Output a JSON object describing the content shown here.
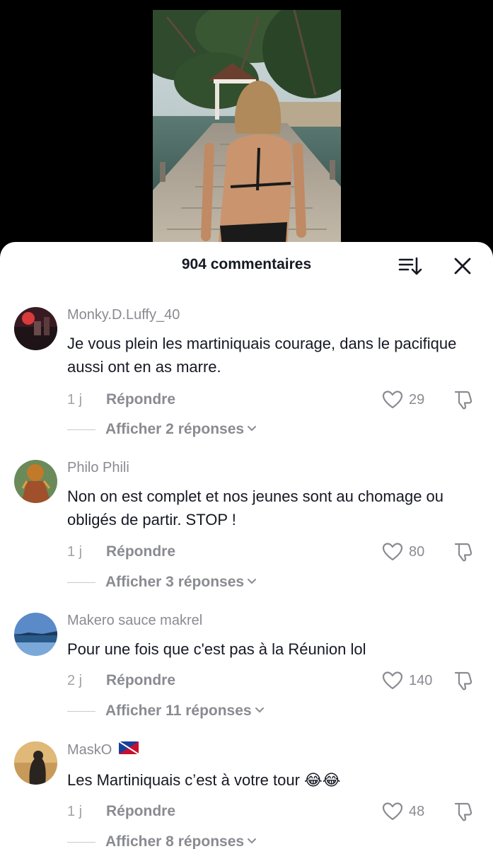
{
  "video": {
    "top_text": "..."
  },
  "sheet": {
    "title": "904 commentaires"
  },
  "icons": {
    "sort": "sort-icon",
    "close": "close-icon",
    "like": "heart-icon",
    "dislike": "thumbs-down-icon",
    "chevron": "chevron-down-icon"
  },
  "comments": [
    {
      "username": "Monky.D.Luffy_40",
      "text": "Je vous plein les martiniquais courage, dans le pacifique aussi ont en as marre.",
      "time": "1 j",
      "reply": "Répondre",
      "likes": "29",
      "replies": "Afficher 2 réponses"
    },
    {
      "username": "Philo Phili",
      "text": "Non on est complet et nos jeunes sont au chomage ou obligés de partir. STOP !",
      "time": "1 j",
      "reply": "Répondre",
      "likes": "80",
      "replies": "Afficher 3 réponses"
    },
    {
      "username": "Makero sauce makrel",
      "text": "Pour une fois que c'est pas à la Réunion lol",
      "time": "2 j",
      "reply": "Répondre",
      "likes": "140",
      "replies": "Afficher 11 réponses"
    },
    {
      "username": "MaskO",
      "text": "Les Martiniquais c’est à votre tour 😂😂",
      "time": "1 j",
      "reply": "Répondre",
      "likes": "48",
      "replies": "Afficher 8 réponses"
    }
  ],
  "colors": {
    "background": "#000000",
    "sheet": "#ffffff",
    "text": "#161823",
    "muted": "#8a8b91"
  }
}
